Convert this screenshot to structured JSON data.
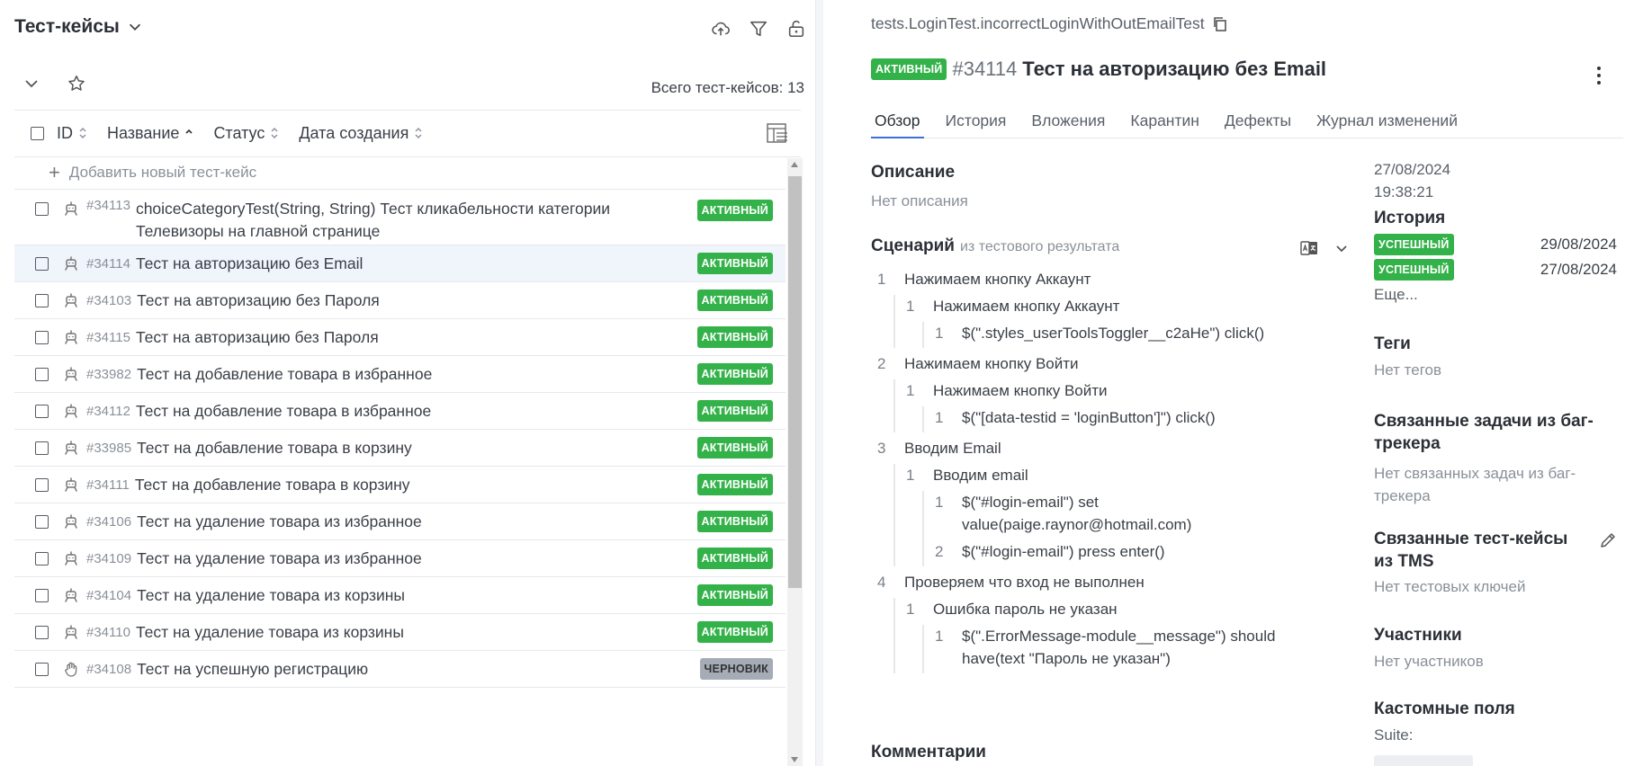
{
  "left": {
    "title": "Тест-кейсы",
    "total": "Всего тест-кейсов: 13",
    "columns": [
      "ID",
      "Название",
      "Статус",
      "Дата создания"
    ],
    "add_label": "Добавить новый тест-кейс",
    "rows": [
      {
        "id": "#34113",
        "name": "choiceCategoryTest(String, String) Тест кликабельности категории Телевизоры на главной странице",
        "status": "АКТИВНЫЙ",
        "icon": "automated-icon"
      },
      {
        "id": "#34114",
        "name": "Тест на авторизацию без Email",
        "status": "АКТИВНЫЙ",
        "icon": "automated-icon"
      },
      {
        "id": "#34103",
        "name": "Тест на авторизацию без Пароля",
        "status": "АКТИВНЫЙ",
        "icon": "automated-icon"
      },
      {
        "id": "#34115",
        "name": "Тест на авторизацию без Пароля",
        "status": "АКТИВНЫЙ",
        "icon": "automated-icon"
      },
      {
        "id": "#33982",
        "name": "Тест на добавление товара в избранное",
        "status": "АКТИВНЫЙ",
        "icon": "automated-icon"
      },
      {
        "id": "#34112",
        "name": "Тест на добавление товара в избранное",
        "status": "АКТИВНЫЙ",
        "icon": "automated-icon"
      },
      {
        "id": "#33985",
        "name": "Тест на добавление товара в корзину",
        "status": "АКТИВНЫЙ",
        "icon": "automated-icon"
      },
      {
        "id": "#34111",
        "name": "Тест на добавление товара в корзину",
        "status": "АКТИВНЫЙ",
        "icon": "automated-icon"
      },
      {
        "id": "#34106",
        "name": "Тест на удаление товара из избранное",
        "status": "АКТИВНЫЙ",
        "icon": "automated-icon"
      },
      {
        "id": "#34109",
        "name": "Тест на удаление товара из избранное",
        "status": "АКТИВНЫЙ",
        "icon": "automated-icon"
      },
      {
        "id": "#34104",
        "name": "Тест на удаление товара из корзины",
        "status": "АКТИВНЫЙ",
        "icon": "automated-icon"
      },
      {
        "id": "#34110",
        "name": "Тест на удаление товара из корзины",
        "status": "АКТИВНЫЙ",
        "icon": "automated-icon"
      },
      {
        "id": "#34108",
        "name": "Тест на успешную регистрацию",
        "status": "ЧЕРНОВИК",
        "icon": "manual-hand-icon"
      }
    ]
  },
  "right": {
    "path": "tests.LoginTest.incorrectLoginWithOutEmailTest",
    "status": "АКТИВНЫЙ",
    "id": "#34114",
    "name": "Тест на авторизацию без Email",
    "tabs": [
      "Обзор",
      "История",
      "Вложения",
      "Карантин",
      "Дефекты",
      "Журнал изменений"
    ],
    "description_title": "Описание",
    "description_value": "Нет описания",
    "scenario_title": "Сценарий",
    "scenario_source": "из тестового результата",
    "steps": {
      "s1": {
        "n": "1",
        "text": "Нажимаем кнопку Аккаунт"
      },
      "s1_1": {
        "n": "1",
        "text": "Нажимаем кнопку Аккаунт"
      },
      "s1_1_1": {
        "n": "1",
        "text": "$(\".styles_userToolsToggler__c2aHe\") click()"
      },
      "s2": {
        "n": "2",
        "text": "Нажимаем кнопку Войти"
      },
      "s2_1": {
        "n": "1",
        "text": "Нажимаем кнопку Войти"
      },
      "s2_1_1": {
        "n": "1",
        "text": "$(\"[data-testid = 'loginButton']\") click()"
      },
      "s3": {
        "n": "3",
        "text": "Вводим Email"
      },
      "s3_1": {
        "n": "1",
        "text": "Вводим email"
      },
      "s3_1_1": {
        "n": "1",
        "text": "$(\"#login-email\") set value(paige.raynor@hotmail.com)"
      },
      "s3_1_2": {
        "n": "2",
        "text": "$(\"#login-email\") press enter()"
      },
      "s4": {
        "n": "4",
        "text": "Проверяем что вход не выполнен"
      },
      "s4_1": {
        "n": "1",
        "text": "Ошибка пароль не указан"
      },
      "s4_1_1": {
        "n": "1",
        "text": "$(\".ErrorMessage-module__message\") should have(text \"Пароль не указан\")"
      }
    },
    "comments_title": "Комментарии",
    "sidebar": {
      "date": "27/08/2024",
      "time": "19:38:21",
      "history_title": "История",
      "history": [
        {
          "status": "УСПЕШНЫЙ",
          "date": "29/08/2024"
        },
        {
          "status": "УСПЕШНЫЙ",
          "date": "27/08/2024"
        }
      ],
      "more": "Еще...",
      "tags_title": "Теги",
      "tags_value": "Нет тегов",
      "issues_title": "Связанные задачи из баг-трекера",
      "issues_value": "Нет связанных задач из баг-трекера",
      "linked_title": "Связанные тест-кейсы из TMS",
      "linked_value": "Нет тестовых ключей",
      "members_title": "Участники",
      "members_value": "Нет участников",
      "custom_title": "Кастомные поля",
      "suite_label": "Suite:"
    }
  },
  "colors": {
    "active_badge": "#34b24a",
    "draft_badge": "#a5acb6",
    "tab_accent": "#3a6fd8",
    "selected_row": "#f0f4fb"
  }
}
